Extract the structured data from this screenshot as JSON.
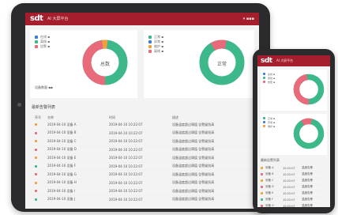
{
  "app": {
    "logo": "sdt",
    "title": "AI 大屏平台",
    "user": "▾  ▪▪▪"
  },
  "panels": [
    {
      "legend": [
        "在线  ▪",
        "离线  ▪",
        "告警  ▪"
      ],
      "center": "总数",
      "values": [
        0.48,
        0.04,
        0.48
      ],
      "footer": "设备数量 ▪▪"
    },
    {
      "legend": [
        "正常  ▪",
        "异常  ▪",
        "维护  ▪",
        "离线  ▪"
      ],
      "center": "正常",
      "values": [
        0.88,
        0.12
      ],
      "footer": ""
    }
  ],
  "list": {
    "title": "最新告警列表",
    "headers": [
      "序号",
      "名称",
      "时间",
      "描述"
    ],
    "rows": [
      [
        "2019-04-10 设备 A",
        "2019-04-10 10:22:07",
        "设备温度超过阈值  告警级别高"
      ],
      [
        "2019-04-10 设备 B",
        "2019-04-10 10:22:07",
        "设备温度超过阈值  告警级别高"
      ],
      [
        "2019-04-10 设备 C",
        "2019-04-10 10:22:07",
        "设备温度超过阈值  告警级别高"
      ],
      [
        "2019-04-10 设备 D",
        "2019-04-10 10:22:07",
        "设备温度超过阈值  告警级别高"
      ],
      [
        "2019-04-10 设备 E",
        "2019-04-10 10:22:07",
        "设备温度超过阈值  告警级别高"
      ],
      [
        "2019-04-10 设备 F",
        "2019-04-10 10:22:07",
        "设备温度超过阈值  告警级别高"
      ],
      [
        "2019-04-10 设备 G",
        "2019-04-10 10:22:07",
        "设备温度超过阈值  告警级别高"
      ],
      [
        "2019-04-10 设备 H",
        "2019-04-10 10:22:07",
        "设备温度超过阈值  告警级别高"
      ],
      [
        "2019-04-10 设备 I",
        "2019-04-10 10:22:07",
        "设备温度超过阈值  告警级别高"
      ],
      [
        "2019-04-10 设备 J",
        "2019-04-10 10:22:07",
        "设备温度超过阈值  告警级别高"
      ]
    ],
    "row_colors": [
      "#f0a13c",
      "#e86a7b",
      "#f0a13c",
      "#e86a7b",
      "#f0a13c",
      "#3db88a",
      "#e86a7b",
      "#f0a13c",
      "#e86a7b",
      "#3db88a"
    ]
  },
  "phone": {
    "title": "AI 大屏平台",
    "list_title": "最新告警列表",
    "rows": [
      [
        "设备 A",
        "10:22:07",
        "温度告警"
      ],
      [
        "设备 B",
        "10:22:07",
        "温度告警"
      ],
      [
        "设备 C",
        "10:22:07",
        "温度告警"
      ],
      [
        "设备 D",
        "10:22:07",
        "温度告警"
      ],
      [
        "设备 E",
        "10:22:07",
        "温度告警"
      ],
      [
        "设备 F",
        "10:22:07",
        "温度告警"
      ],
      [
        "设备 G",
        "10:22:07",
        "温度告警"
      ]
    ]
  },
  "colors": {
    "brand": "#a51e2e",
    "green": "#3db88a",
    "pink": "#e86a7b",
    "orange": "#f0a13c",
    "blue": "#3b7dd8"
  }
}
